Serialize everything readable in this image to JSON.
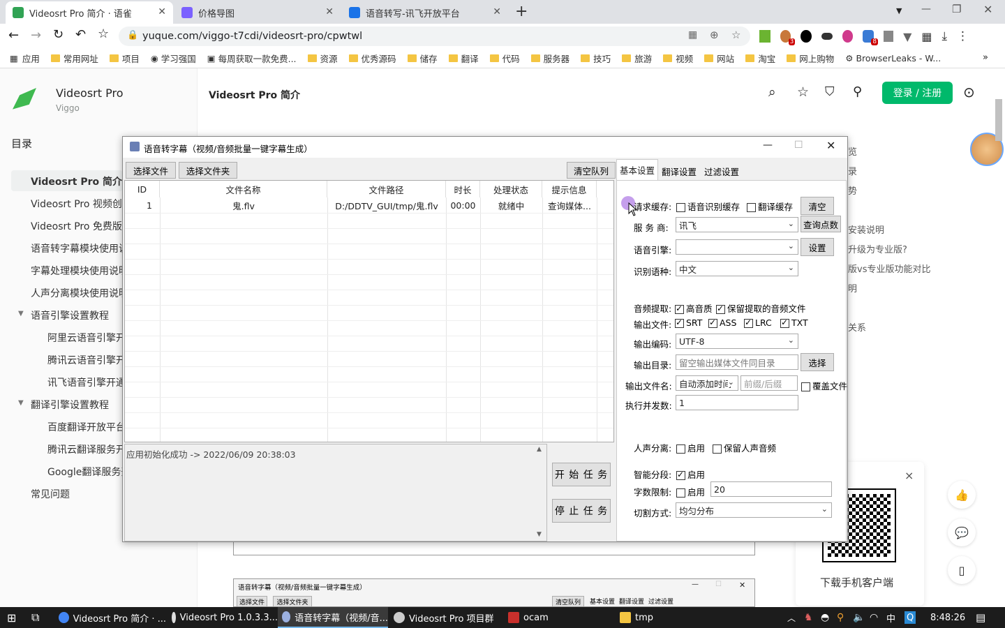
{
  "browser": {
    "tabs": [
      {
        "title": "Videosrt Pro 简介 · 语雀",
        "active": true,
        "color": "#31a354"
      },
      {
        "title": "价格导图",
        "active": false,
        "color": "#7b61ff"
      },
      {
        "title": "语音转写-讯飞开放平台",
        "active": false,
        "color": "#1a73e8"
      }
    ],
    "new_tab": "+",
    "url": "yuque.com/viggo-t7cdi/videosrt-pro/cpwtwl",
    "bookmarks": [
      "应用",
      "常用网址",
      "项目",
      "学习强国",
      "每周获取一款免费...",
      "资源",
      "优秀源码",
      "储存",
      "翻译",
      "代码",
      "服务器",
      "技巧",
      "旅游",
      "视频",
      "网站",
      "淘宝",
      "网上购物",
      "BrowserLeaks - W..."
    ],
    "extension_badge_1": "3",
    "extension_badge_2": "8"
  },
  "yuque": {
    "book_title": "Videosrt Pro",
    "book_owner": "Viggo",
    "doc_title": "Videosrt Pro 简介",
    "login_btn": "登录 / 注册",
    "toc_header": "目录",
    "toc": [
      "Videosrt Pro 简介",
      "Videosrt Pro 视频创意",
      "Videosrt Pro 免费版vs",
      "语音转字幕模块使用说",
      "字幕处理模块使用说明",
      "人声分离模块使用说明",
      "语音引擎设置教程",
      "阿里云语音引擎开",
      "腾讯云语音引擎开",
      "讯飞语音引擎开通",
      "翻译引擎设置教程",
      "百度翻译开放平台",
      "腾讯云翻译服务开",
      "Google翻译服务开",
      "常见问题"
    ],
    "right_links": [
      "览",
      "录",
      "势",
      "安装说明",
      "升级为专业版?",
      "版vs专业版功能对比",
      "明",
      "关系"
    ],
    "qr_caption": "下载手机客户端",
    "qr_close": "×"
  },
  "dialog": {
    "title": "语音转字幕（视频/音频批量一键字幕生成）",
    "btn_select_file": "选择文件",
    "btn_select_folder": "选择文件夹",
    "btn_clear_queue": "清空队列",
    "tabs": [
      "基本设置",
      "翻译设置",
      "过滤设置"
    ],
    "columns": [
      "ID",
      "文件名称",
      "文件路径",
      "时长",
      "处理状态",
      "提示信息"
    ],
    "rows": [
      {
        "id": "1",
        "name": "鬼.flv",
        "path": "D:/DDTV_GUI/tmp/鬼.flv",
        "duration": "00:00",
        "status": "就绪中",
        "info": "查询媒体..."
      }
    ],
    "log": "应用初始化成功  ->  2022/06/09 20:38:03",
    "btn_start": "开 始 任 务",
    "btn_stop": "停 止 任 务",
    "settings": {
      "cache_label": "请求缓存:",
      "cache_opt1": "语音识别缓存",
      "cache_opt2": "翻译缓存",
      "btn_clear": "清空",
      "provider_label": "服 务 商:",
      "provider_value": "讯飞",
      "btn_query": "查询点数",
      "engine_label": "语音引擎:",
      "engine_value": "",
      "btn_setting": "设置",
      "lang_label": "识别语种:",
      "lang_value": "中文",
      "audio_label": "音频提取:",
      "audio_opt1": "高音质",
      "audio_opt2": "保留提取的音频文件",
      "out_label": "输出文件:",
      "out_srt": "SRT",
      "out_ass": "ASS",
      "out_lrc": "LRC",
      "out_txt": "TXT",
      "enc_label": "输出编码:",
      "enc_value": "UTF-8",
      "dir_label": "输出目录:",
      "dir_placeholder": "留空输出媒体文件同目录",
      "btn_choose": "选择",
      "fname_label": "输出文件名:",
      "fname_value": "自动添加时间",
      "fname_placeholder": "前缀/后缀",
      "overwrite": "覆盖文件",
      "conc_label": "执行并发数:",
      "conc_value": "1",
      "vocal_label": "人声分离:",
      "vocal_opt1": "启用",
      "vocal_opt2": "保留人声音频",
      "seg_label": "智能分段:",
      "seg_opt": "启用",
      "limit_label": "字数限制:",
      "limit_opt": "启用",
      "limit_value": "20",
      "split_label": "切割方式:",
      "split_value": "均匀分布"
    }
  },
  "preview": {
    "title": "语音转字幕（视频/音频批量一键字幕生成）",
    "b1": "选择文件",
    "b2": "选择文件夹",
    "b3": "清空队列",
    "t1": "基本设置",
    "t2": "翻译设置",
    "t3": "过滤设置"
  },
  "taskbar": {
    "items": [
      "Videosrt Pro 简介 · ...",
      "Videosrt Pro 1.0.3.3...",
      "语音转字幕（视频/音...",
      "Videosrt Pro 项目群",
      "ocam",
      "tmp"
    ],
    "ime": "中",
    "time": "8:48:26"
  }
}
